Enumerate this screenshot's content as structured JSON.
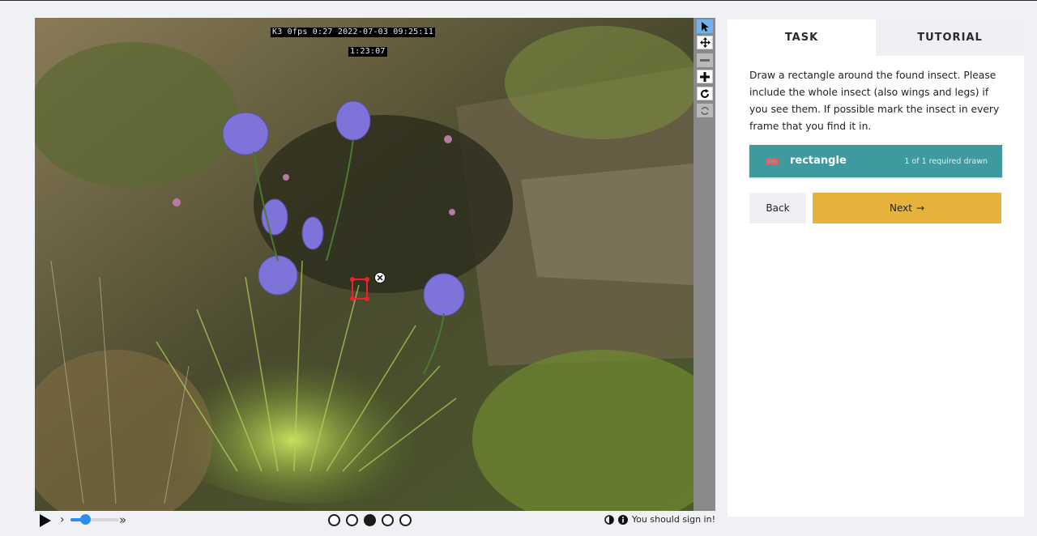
{
  "viewer": {
    "overlay_line1": "K3 0fps 0:27 2022-07-03 09:25:11",
    "overlay_line2": "1:23:07"
  },
  "toolbar": {
    "tools": [
      {
        "name": "pointer",
        "icon": "cursor-arrow-icon",
        "state": "active"
      },
      {
        "name": "move",
        "icon": "move-arrows-icon",
        "state": "normal"
      },
      {
        "name": "zoom-out",
        "icon": "minus-icon",
        "state": "disabled"
      },
      {
        "name": "zoom-in",
        "icon": "plus-icon",
        "state": "normal"
      },
      {
        "name": "rotate",
        "icon": "rotate-icon",
        "state": "normal"
      },
      {
        "name": "reset",
        "icon": "refresh-icon",
        "state": "disabled"
      }
    ]
  },
  "controls": {
    "speed_min": "›",
    "speed_max": "»",
    "speed_level": 0.3,
    "frames": [
      false,
      false,
      true,
      false,
      false
    ],
    "status_text": "You should sign in!"
  },
  "panel": {
    "tab_task": "TASK",
    "tab_tutorial": "TUTORIAL",
    "instructions": "Draw a rectangle around the found insect. Please include the whole insect (also wings and legs) if you see them. If possible mark the insect in every frame that you find it in.",
    "tool_label": "rectangle",
    "tool_count": "1 of 1 required drawn",
    "back_label": "Back",
    "next_label": "Next",
    "next_arrow": "→"
  },
  "colors": {
    "accent_teal": "#3f9aa0",
    "next_yellow": "#e6b23b",
    "annotation_red": "#e8252c",
    "slider_blue": "#2f8cf1"
  }
}
